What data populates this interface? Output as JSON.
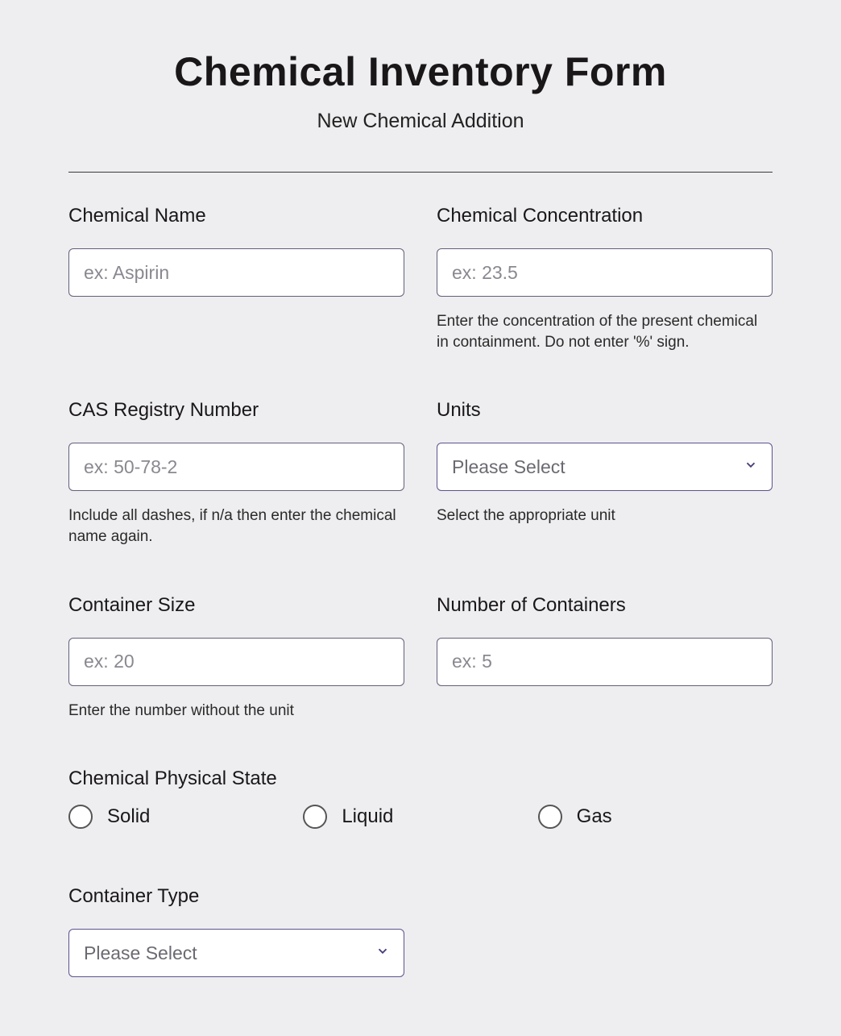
{
  "header": {
    "title": "Chemical Inventory Form",
    "subtitle": "New Chemical Addition"
  },
  "fields": {
    "chemical_name": {
      "label": "Chemical Name",
      "placeholder": "ex: Aspirin",
      "value": ""
    },
    "concentration": {
      "label": "Chemical Concentration",
      "placeholder": "ex: 23.5",
      "value": "",
      "help": "Enter the concentration of the present chemical in containment. Do not enter '%' sign."
    },
    "cas": {
      "label": "CAS Registry Number",
      "placeholder": "ex: 50-78-2",
      "value": "",
      "help": "Include all dashes, if n/a then enter the chemical name again."
    },
    "units": {
      "label": "Units",
      "selected": "Please Select",
      "help": "Select the appropriate unit"
    },
    "container_size": {
      "label": "Container Size",
      "placeholder": "ex: 20",
      "value": "",
      "help": "Enter the number without the unit"
    },
    "num_containers": {
      "label": "Number of Containers",
      "placeholder": "ex: 5",
      "value": ""
    },
    "physical_state": {
      "label": "Chemical Physical State",
      "options": [
        "Solid",
        "Liquid",
        "Gas"
      ]
    },
    "container_type": {
      "label": "Container Type",
      "selected": "Please Select"
    }
  }
}
